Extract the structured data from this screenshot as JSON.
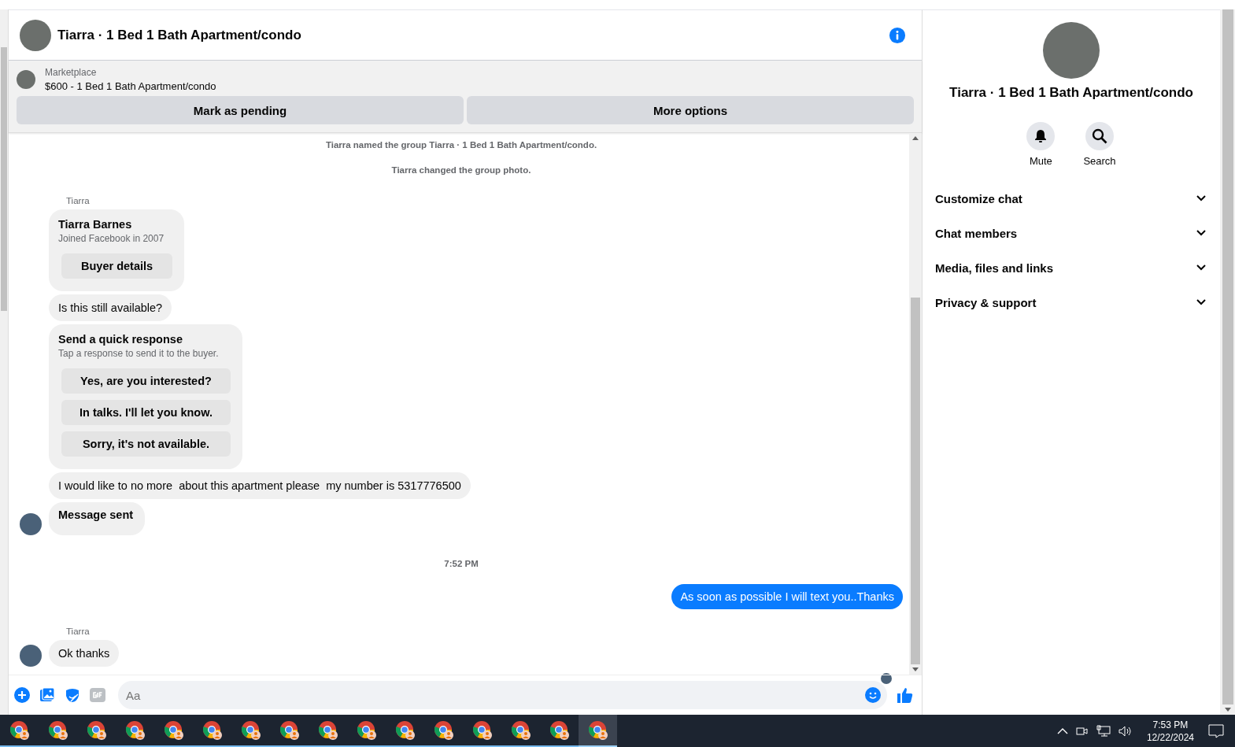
{
  "header": {
    "title": "Tiarra · 1 Bed 1 Bath Apartment/condo"
  },
  "listing": {
    "source": "Marketplace",
    "title": "$600 - 1 Bed 1 Bath Apartment/condo",
    "buttons": [
      "Mark as pending",
      "More options"
    ]
  },
  "messages": [
    {
      "kind": "event",
      "text": "Tiarra named the group Tiarra · 1 Bed 1 Bath Apartment/condo."
    },
    {
      "kind": "event",
      "text": "Tiarra changed the group photo."
    },
    {
      "kind": "sender",
      "text": "Tiarra"
    },
    {
      "kind": "profile_card",
      "name": "Tiarra Barnes",
      "subtitle": "Joined Facebook in 2007",
      "button": "Buyer details"
    },
    {
      "kind": "incoming",
      "text": "Is this still available?",
      "avatar": false
    },
    {
      "kind": "quick_replies",
      "title": "Send a quick response",
      "subtitle": "Tap a response to send it to the buyer.",
      "options": [
        "Yes, are you interested?",
        "In talks. I'll let you know.",
        "Sorry, it's not available."
      ]
    },
    {
      "kind": "incoming",
      "text": "I would like to no more  about this apartment please  my number is 5317776500",
      "avatar": false
    },
    {
      "kind": "notice",
      "text": "Message sent",
      "avatar": true
    },
    {
      "kind": "time",
      "text": "7:52 PM"
    },
    {
      "kind": "outgoing",
      "text": "As soon as possible I will text you..Thanks"
    },
    {
      "kind": "sender",
      "text": "Tiarra"
    },
    {
      "kind": "incoming",
      "text": "Ok thanks",
      "avatar": true
    },
    {
      "kind": "seen"
    }
  ],
  "composer": {
    "placeholder": "Aa"
  },
  "panel": {
    "title": "Tiarra · 1 Bed 1 Bath Apartment/condo",
    "actions": [
      {
        "kind": "mute",
        "label": "Mute"
      },
      {
        "kind": "search",
        "label": "Search"
      }
    ],
    "sections": [
      {
        "label": "Customize chat",
        "expanded": false
      },
      {
        "label": "Chat members",
        "expanded": false
      },
      {
        "label": "Media, files and links",
        "expanded": false
      },
      {
        "label": "Privacy & support",
        "expanded": false
      }
    ]
  },
  "taskbar": {
    "apps": [
      {
        "selected": false
      },
      {
        "selected": false
      },
      {
        "selected": false
      },
      {
        "selected": false
      },
      {
        "selected": false
      },
      {
        "selected": false
      },
      {
        "selected": false
      },
      {
        "selected": false
      },
      {
        "selected": false
      },
      {
        "selected": false
      },
      {
        "selected": false
      },
      {
        "selected": false
      },
      {
        "selected": false
      },
      {
        "selected": false
      },
      {
        "selected": false
      },
      {
        "selected": true
      }
    ],
    "time": "7:53 PM",
    "date": "12/22/2024"
  }
}
